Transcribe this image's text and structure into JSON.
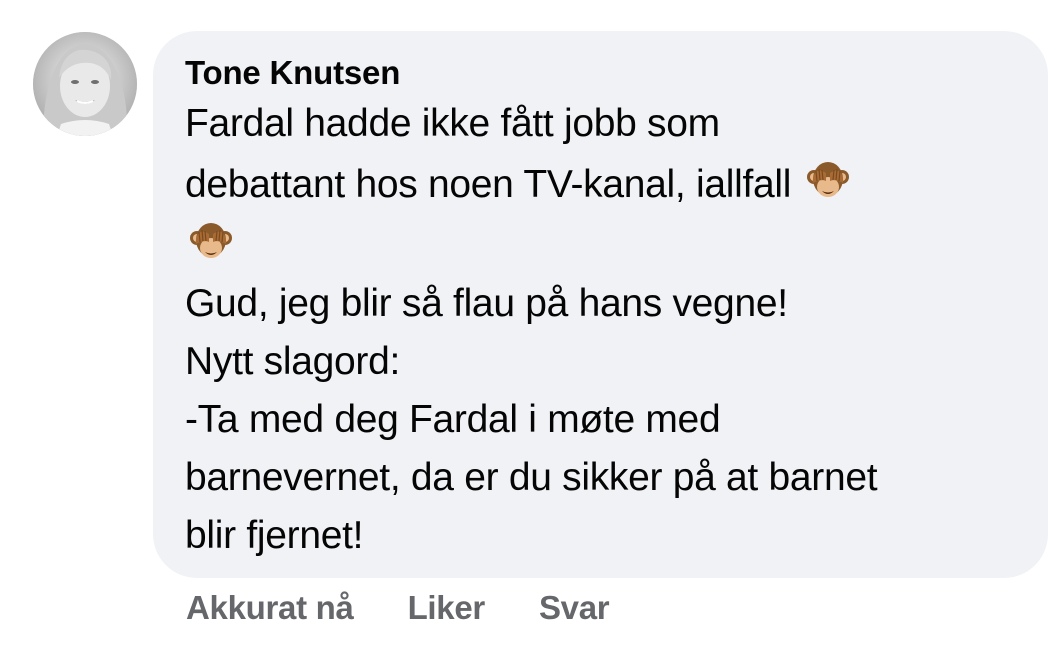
{
  "comment": {
    "author": "Tone Knutsen",
    "lines": [
      "Fardal hadde ikke fått jobb som",
      "debattant hos noen TV-kanal, iallfall",
      "Gud, jeg blir så flau på hans vegne!",
      "Nytt slagord:",
      "-Ta med deg Fardal i møte med",
      "barnevernet, da er du sikker på at barnet",
      "blir fjernet!"
    ],
    "emoji": [
      "see-no-evil-monkey-icon",
      "see-no-evil-monkey-icon"
    ],
    "bubble_color": "#f0f2f5"
  },
  "actions": {
    "timestamp": "Akkurat nå",
    "like_label": "Liker",
    "reply_label": "Svar"
  }
}
